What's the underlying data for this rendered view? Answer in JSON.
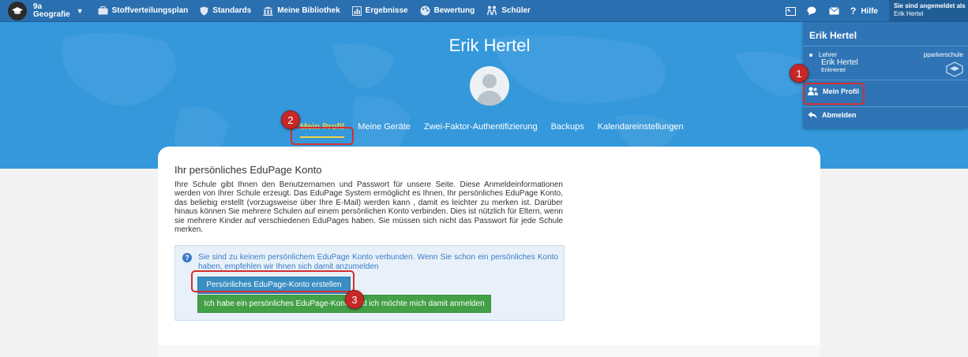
{
  "topbar": {
    "class": "9a",
    "subject": "Geografie",
    "nav": [
      {
        "label": "Stoffverteilungsplan",
        "icon": "briefcase-icon"
      },
      {
        "label": "Standards",
        "icon": "shield-icon"
      },
      {
        "label": "Meine Bibliothek",
        "icon": "library-icon"
      },
      {
        "label": "Ergebnisse",
        "icon": "grades-icon"
      },
      {
        "label": "Bewertung",
        "icon": "palette-icon"
      },
      {
        "label": "Schüler",
        "icon": "students-icon"
      }
    ],
    "help": "Hilfe",
    "logged_in_as": "Sie sind angemeldet als",
    "logged_in_user": "Erik Hertel"
  },
  "profile": {
    "name": "Erik Hertel",
    "tabs": [
      "Mein Profil",
      "Meine Geräte",
      "Zwei-Faktor-Authentifizierung",
      "Backups",
      "Kalendareinstellungen"
    ]
  },
  "dropdown": {
    "title": "Erik Hertel",
    "role": "Lehrer",
    "user_name": "Erik Hertel",
    "user_login": "ErikHertel",
    "school": "pparkerschule",
    "profile_link": "Mein Profil",
    "logout": "Abmelden"
  },
  "content": {
    "title": "Ihr persönliches EduPage Konto",
    "description": "Ihre Schule gibt Ihnen den Benutzernamen und Passwort für unsere Seite. Diese Anmeldeinformationen werden von Ihrer Schule erzeugt. Das EduPage System ermöglicht es Ihnen, Ihr persönliches EduPage Konto, das beliebig erstellt (vorzugsweise über Ihre E-Mail) werden kann , damit es leichter zu merken ist. Darüber hinaus können Sie mehrere Schulen auf einem persönlichen Konto verbinden. Dies ist nützlich für Eltern, wenn sie mehrere Kinder auf verschiedenen EduPages haben. Sie müssen sich nicht das Passwort für jede Schule merken.",
    "info": "Sie sind zu keinem persönlichem EduPage Konto verbunden. Wenn Sie schon ein persönliches Konto haben, empfehlen wir Ihnen sich damit anzumelden",
    "btn_create": "Persönliches EduPage-Konto erstellen",
    "btn_login": "Ich habe ein persönliches EduPage-Konto und ich möchte mich damit anmelden"
  },
  "annotations": [
    "1",
    "2",
    "3"
  ],
  "colors": {
    "topbar": "#2a6fb0",
    "hero": "#3498db",
    "active_tab": "#f4d03f",
    "marker": "#c62828"
  }
}
